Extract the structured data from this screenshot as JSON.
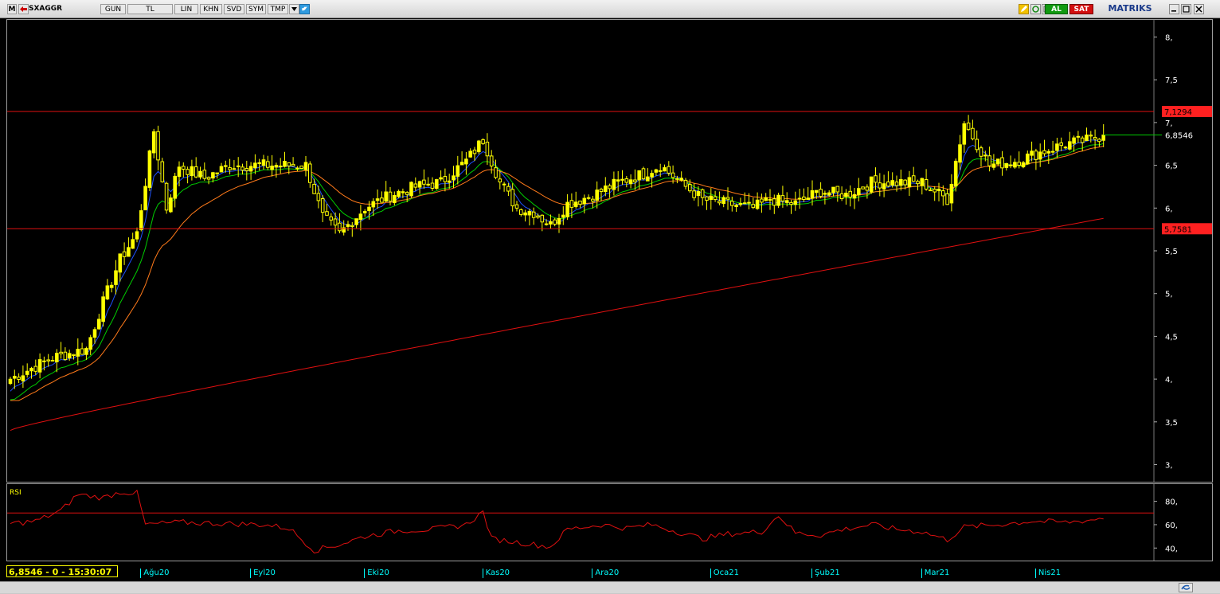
{
  "toolbar": {
    "logo": "M",
    "symbol": "SXAGGR",
    "buttons": [
      "GUN",
      "TL",
      "LIN",
      "KHN",
      "SVD",
      "SYM",
      "TMP"
    ],
    "buy_label": "AL",
    "sell_label": "SAT",
    "brand": "MATRIKS"
  },
  "status": {
    "readout": "6,8546 - 0 - 15:30:07"
  },
  "price_tags": {
    "upper": "7,1294",
    "last": "6,8546",
    "lower": "5,7581"
  },
  "rsi_label": "RSI",
  "colors": {
    "candle": "#ffff00",
    "ma_fast": "#1e50ff",
    "ma_mid": "#00cc00",
    "ma_slow": "#ff7a1a",
    "ma_long": "#e01010",
    "hline": "#e01010",
    "last_line": "#00cc00",
    "axis_text": "#ffffff",
    "date_text": "#00ffff"
  },
  "chart_data": [
    {
      "type": "candlestick",
      "ylim": [
        2.8,
        8.2
      ],
      "yticks": [
        "8,",
        "7,5",
        "7,",
        "6,5",
        "6,",
        "5,5",
        "5,",
        "4,5",
        "4,",
        "3,5",
        "3,"
      ],
      "ytick_values": [
        8,
        7.5,
        7,
        6.5,
        6,
        5.5,
        5,
        4.5,
        4,
        3.5,
        3
      ],
      "x_labels": [
        "Ağu20",
        "Eyl20",
        "Eki20",
        "Kas20",
        "Ara20",
        "Oca21",
        "Şub21",
        "Mar21",
        "Nis21"
      ],
      "horizontal_lines": [
        7.1294,
        5.7581
      ],
      "last_price": 6.8546,
      "close_anchors": [
        [
          0,
          4.0
        ],
        [
          10,
          4.25
        ],
        [
          18,
          4.35
        ],
        [
          22,
          4.9
        ],
        [
          26,
          5.4
        ],
        [
          30,
          5.7
        ],
        [
          34,
          6.9
        ],
        [
          37,
          6.0
        ],
        [
          40,
          6.5
        ],
        [
          46,
          6.35
        ],
        [
          52,
          6.5
        ],
        [
          58,
          6.5
        ],
        [
          64,
          6.5
        ],
        [
          70,
          6.5
        ],
        [
          74,
          5.9
        ],
        [
          78,
          5.7
        ],
        [
          84,
          6.0
        ],
        [
          90,
          6.15
        ],
        [
          96,
          6.25
        ],
        [
          102,
          6.3
        ],
        [
          108,
          6.55
        ],
        [
          112,
          6.8
        ],
        [
          116,
          6.3
        ],
        [
          120,
          6.0
        ],
        [
          124,
          5.95
        ],
        [
          128,
          5.8
        ],
        [
          132,
          6.05
        ],
        [
          138,
          6.15
        ],
        [
          144,
          6.3
        ],
        [
          150,
          6.4
        ],
        [
          154,
          6.5
        ],
        [
          160,
          6.25
        ],
        [
          164,
          6.1
        ],
        [
          170,
          6.05
        ],
        [
          176,
          6.0
        ],
        [
          180,
          6.1
        ],
        [
          186,
          6.05
        ],
        [
          192,
          6.2
        ],
        [
          198,
          6.15
        ],
        [
          204,
          6.3
        ],
        [
          210,
          6.3
        ],
        [
          216,
          6.3
        ],
        [
          222,
          6.1
        ],
        [
          226,
          7.0
        ],
        [
          232,
          6.5
        ],
        [
          238,
          6.55
        ],
        [
          244,
          6.65
        ],
        [
          250,
          6.75
        ],
        [
          256,
          6.8
        ],
        [
          259,
          6.8546
        ]
      ],
      "ma_long": {
        "start": 3.4,
        "end": 5.88
      }
    },
    {
      "type": "line",
      "series": [
        {
          "name": "RSI"
        }
      ],
      "ylim": [
        32,
        92
      ],
      "yticks": [
        "80,",
        "60,",
        "40,"
      ],
      "ytick_values": [
        80,
        60,
        40
      ],
      "horizontal_lines": [
        70
      ],
      "anchors": [
        [
          0,
          61
        ],
        [
          6,
          63
        ],
        [
          12,
          72
        ],
        [
          16,
          86
        ],
        [
          22,
          83
        ],
        [
          26,
          88
        ],
        [
          30,
          87
        ],
        [
          32,
          60
        ],
        [
          40,
          62
        ],
        [
          50,
          61
        ],
        [
          60,
          60
        ],
        [
          66,
          57
        ],
        [
          72,
          38
        ],
        [
          78,
          43
        ],
        [
          84,
          50
        ],
        [
          92,
          55
        ],
        [
          100,
          56
        ],
        [
          108,
          60
        ],
        [
          112,
          71
        ],
        [
          114,
          48
        ],
        [
          120,
          45
        ],
        [
          128,
          41
        ],
        [
          132,
          56
        ],
        [
          140,
          60
        ],
        [
          146,
          57
        ],
        [
          152,
          60
        ],
        [
          160,
          52
        ],
        [
          164,
          48
        ],
        [
          170,
          52
        ],
        [
          178,
          54
        ],
        [
          182,
          68
        ],
        [
          186,
          53
        ],
        [
          192,
          51
        ],
        [
          196,
          55
        ],
        [
          204,
          60
        ],
        [
          210,
          56
        ],
        [
          216,
          54
        ],
        [
          222,
          47
        ],
        [
          226,
          58
        ],
        [
          234,
          60
        ],
        [
          242,
          63
        ],
        [
          250,
          62
        ],
        [
          256,
          64
        ],
        [
          259,
          66
        ]
      ]
    }
  ]
}
